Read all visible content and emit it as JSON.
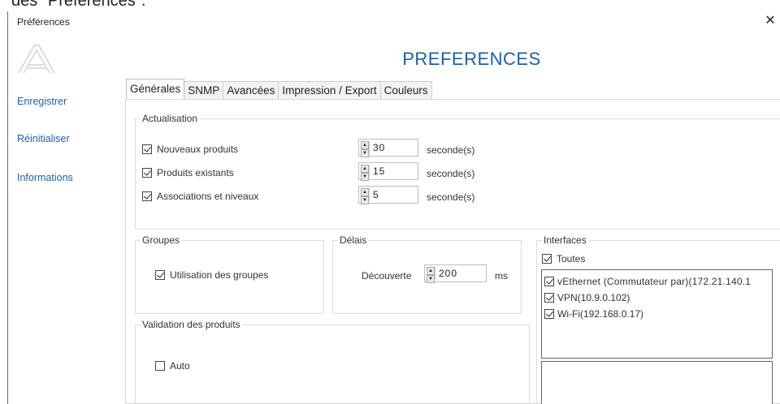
{
  "caption": "des \"Préférences\".",
  "window": {
    "title": "Préférences",
    "close_glyph": "✕"
  },
  "sidebar": {
    "items": [
      {
        "label": "Enregistrer"
      },
      {
        "label": "Réinitialiser"
      },
      {
        "label": "Informations"
      }
    ]
  },
  "heading": "PREFERENCES",
  "tabs": [
    {
      "label": "Générales",
      "active": true
    },
    {
      "label": "SNMP"
    },
    {
      "label": "Avancées"
    },
    {
      "label": "Impression / Export"
    },
    {
      "label": "Couleurs"
    }
  ],
  "actualisation": {
    "legend": "Actualisation",
    "rows": [
      {
        "label": "Nouveaux produits",
        "checked": true,
        "value": "30",
        "unit": "seconde(s)"
      },
      {
        "label": "Produits existants",
        "checked": true,
        "value": "15",
        "unit": "seconde(s)"
      },
      {
        "label": "Associations et niveaux",
        "checked": true,
        "value": "5",
        "unit": "seconde(s)"
      }
    ]
  },
  "groupes": {
    "legend": "Groupes",
    "option": "Utilisation des groupes",
    "checked": true
  },
  "delais": {
    "legend": "Délais",
    "label": "Découverte",
    "value": "200",
    "unit": "ms"
  },
  "validation": {
    "legend": "Validation des produits",
    "option": "Auto",
    "checked": false
  },
  "interfaces": {
    "legend": "Interfaces",
    "all_label": "Toutes",
    "all_checked": true,
    "items": [
      {
        "label": "vEthernet (Commutateur par)(172.21.140.1",
        "checked": true
      },
      {
        "label": "VPN(10.9.0.102)",
        "checked": true
      },
      {
        "label": "Wi-Fi(192.168.0.17)",
        "checked": true
      }
    ]
  },
  "colors": {
    "accent": "#1e5ea6",
    "link": "#1f5fa8",
    "window_border": "#2b79d6"
  }
}
